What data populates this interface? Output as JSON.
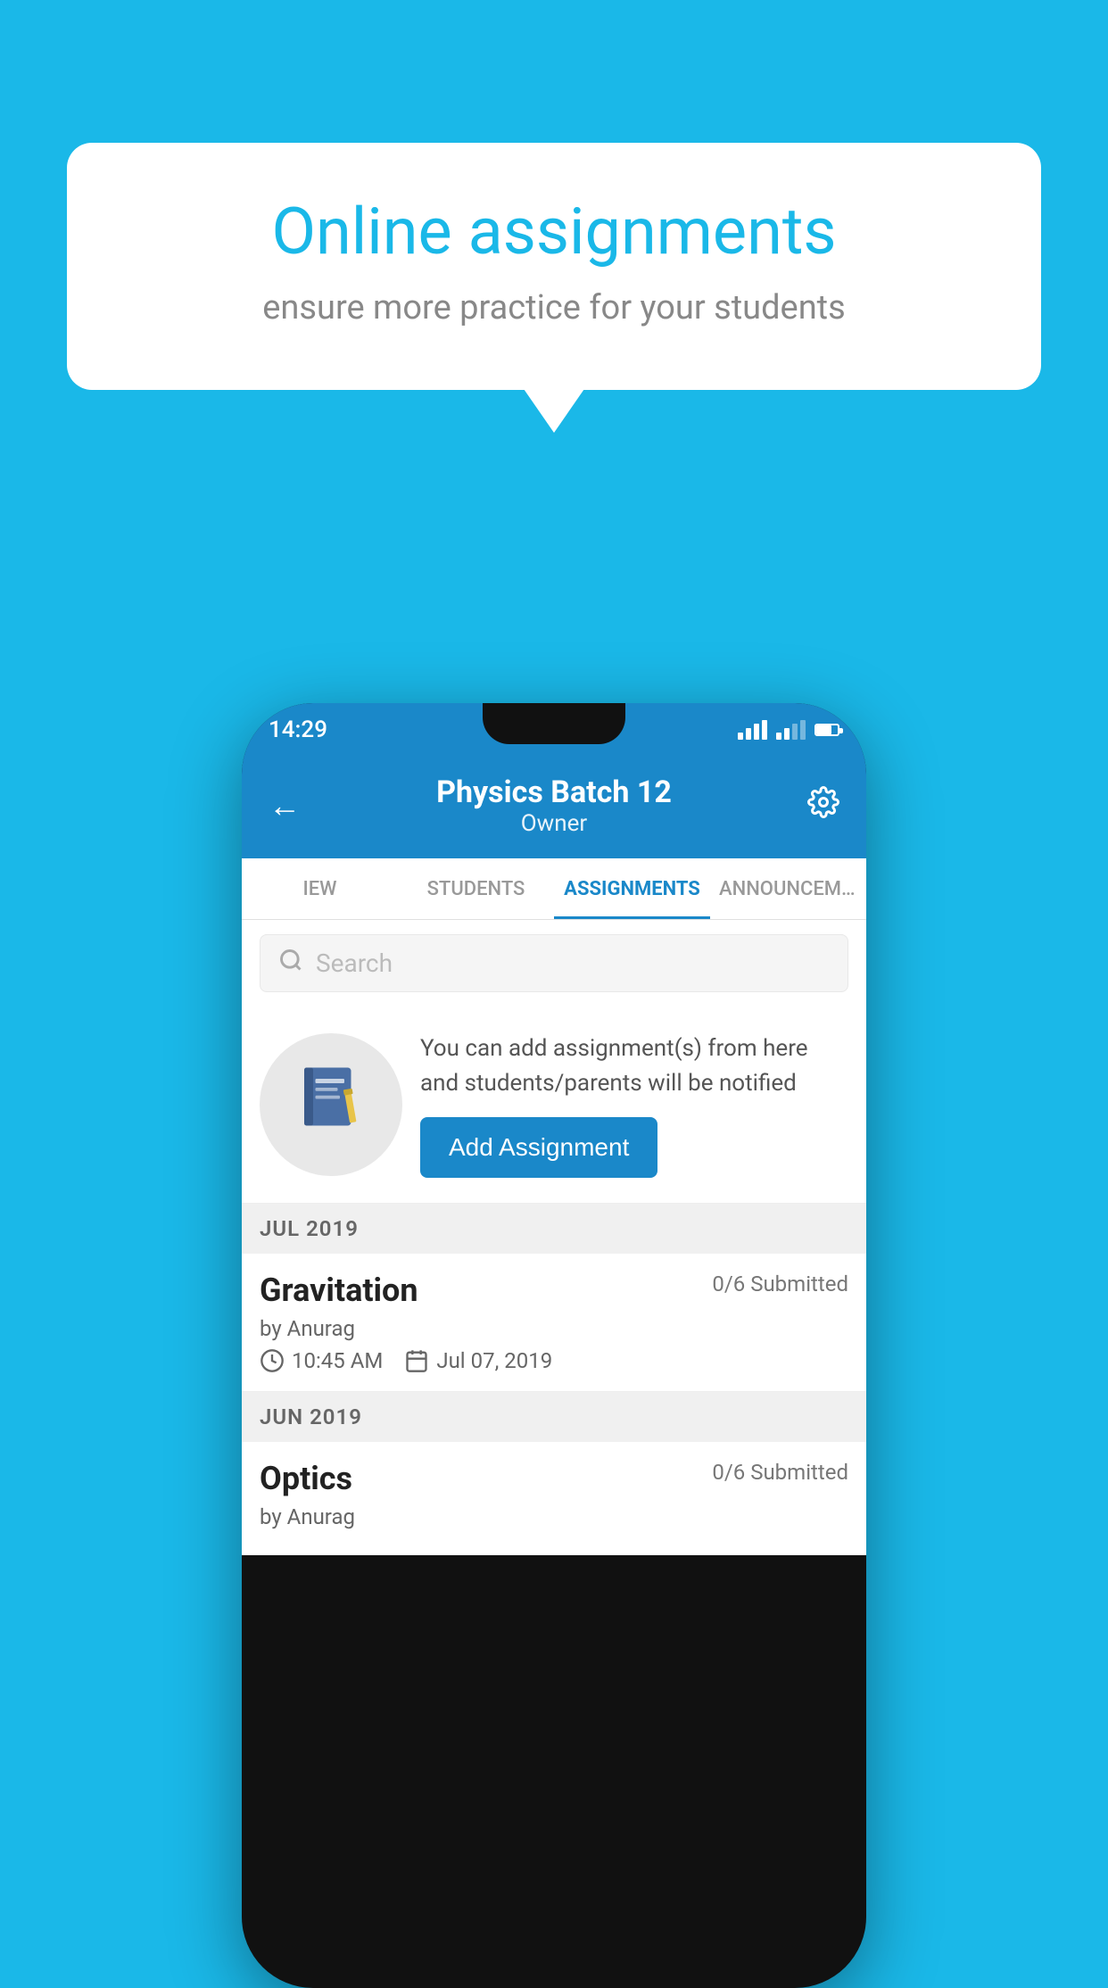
{
  "background_color": "#1ab8e8",
  "speech_bubble": {
    "title": "Online assignments",
    "subtitle": "ensure more practice for your students"
  },
  "phone": {
    "status_bar": {
      "time": "14:29"
    },
    "header": {
      "title": "Physics Batch 12",
      "subtitle": "Owner",
      "back_label": "←",
      "settings_label": "⚙"
    },
    "tabs": [
      {
        "label": "IEW",
        "active": false
      },
      {
        "label": "STUDENTS",
        "active": false
      },
      {
        "label": "ASSIGNMENTS",
        "active": true
      },
      {
        "label": "ANNOUNCEMENTS",
        "active": false
      }
    ],
    "search": {
      "placeholder": "Search"
    },
    "promo": {
      "description": "You can add assignment(s) from here and students/parents will be notified",
      "button_label": "Add Assignment"
    },
    "sections": [
      {
        "month_label": "JUL 2019",
        "assignments": [
          {
            "name": "Gravitation",
            "status": "0/6 Submitted",
            "author": "by Anurag",
            "time": "10:45 AM",
            "date": "Jul 07, 2019"
          }
        ]
      },
      {
        "month_label": "JUN 2019",
        "assignments": [
          {
            "name": "Optics",
            "status": "0/6 Submitted",
            "author": "by Anurag",
            "time": "",
            "date": ""
          }
        ]
      }
    ]
  }
}
